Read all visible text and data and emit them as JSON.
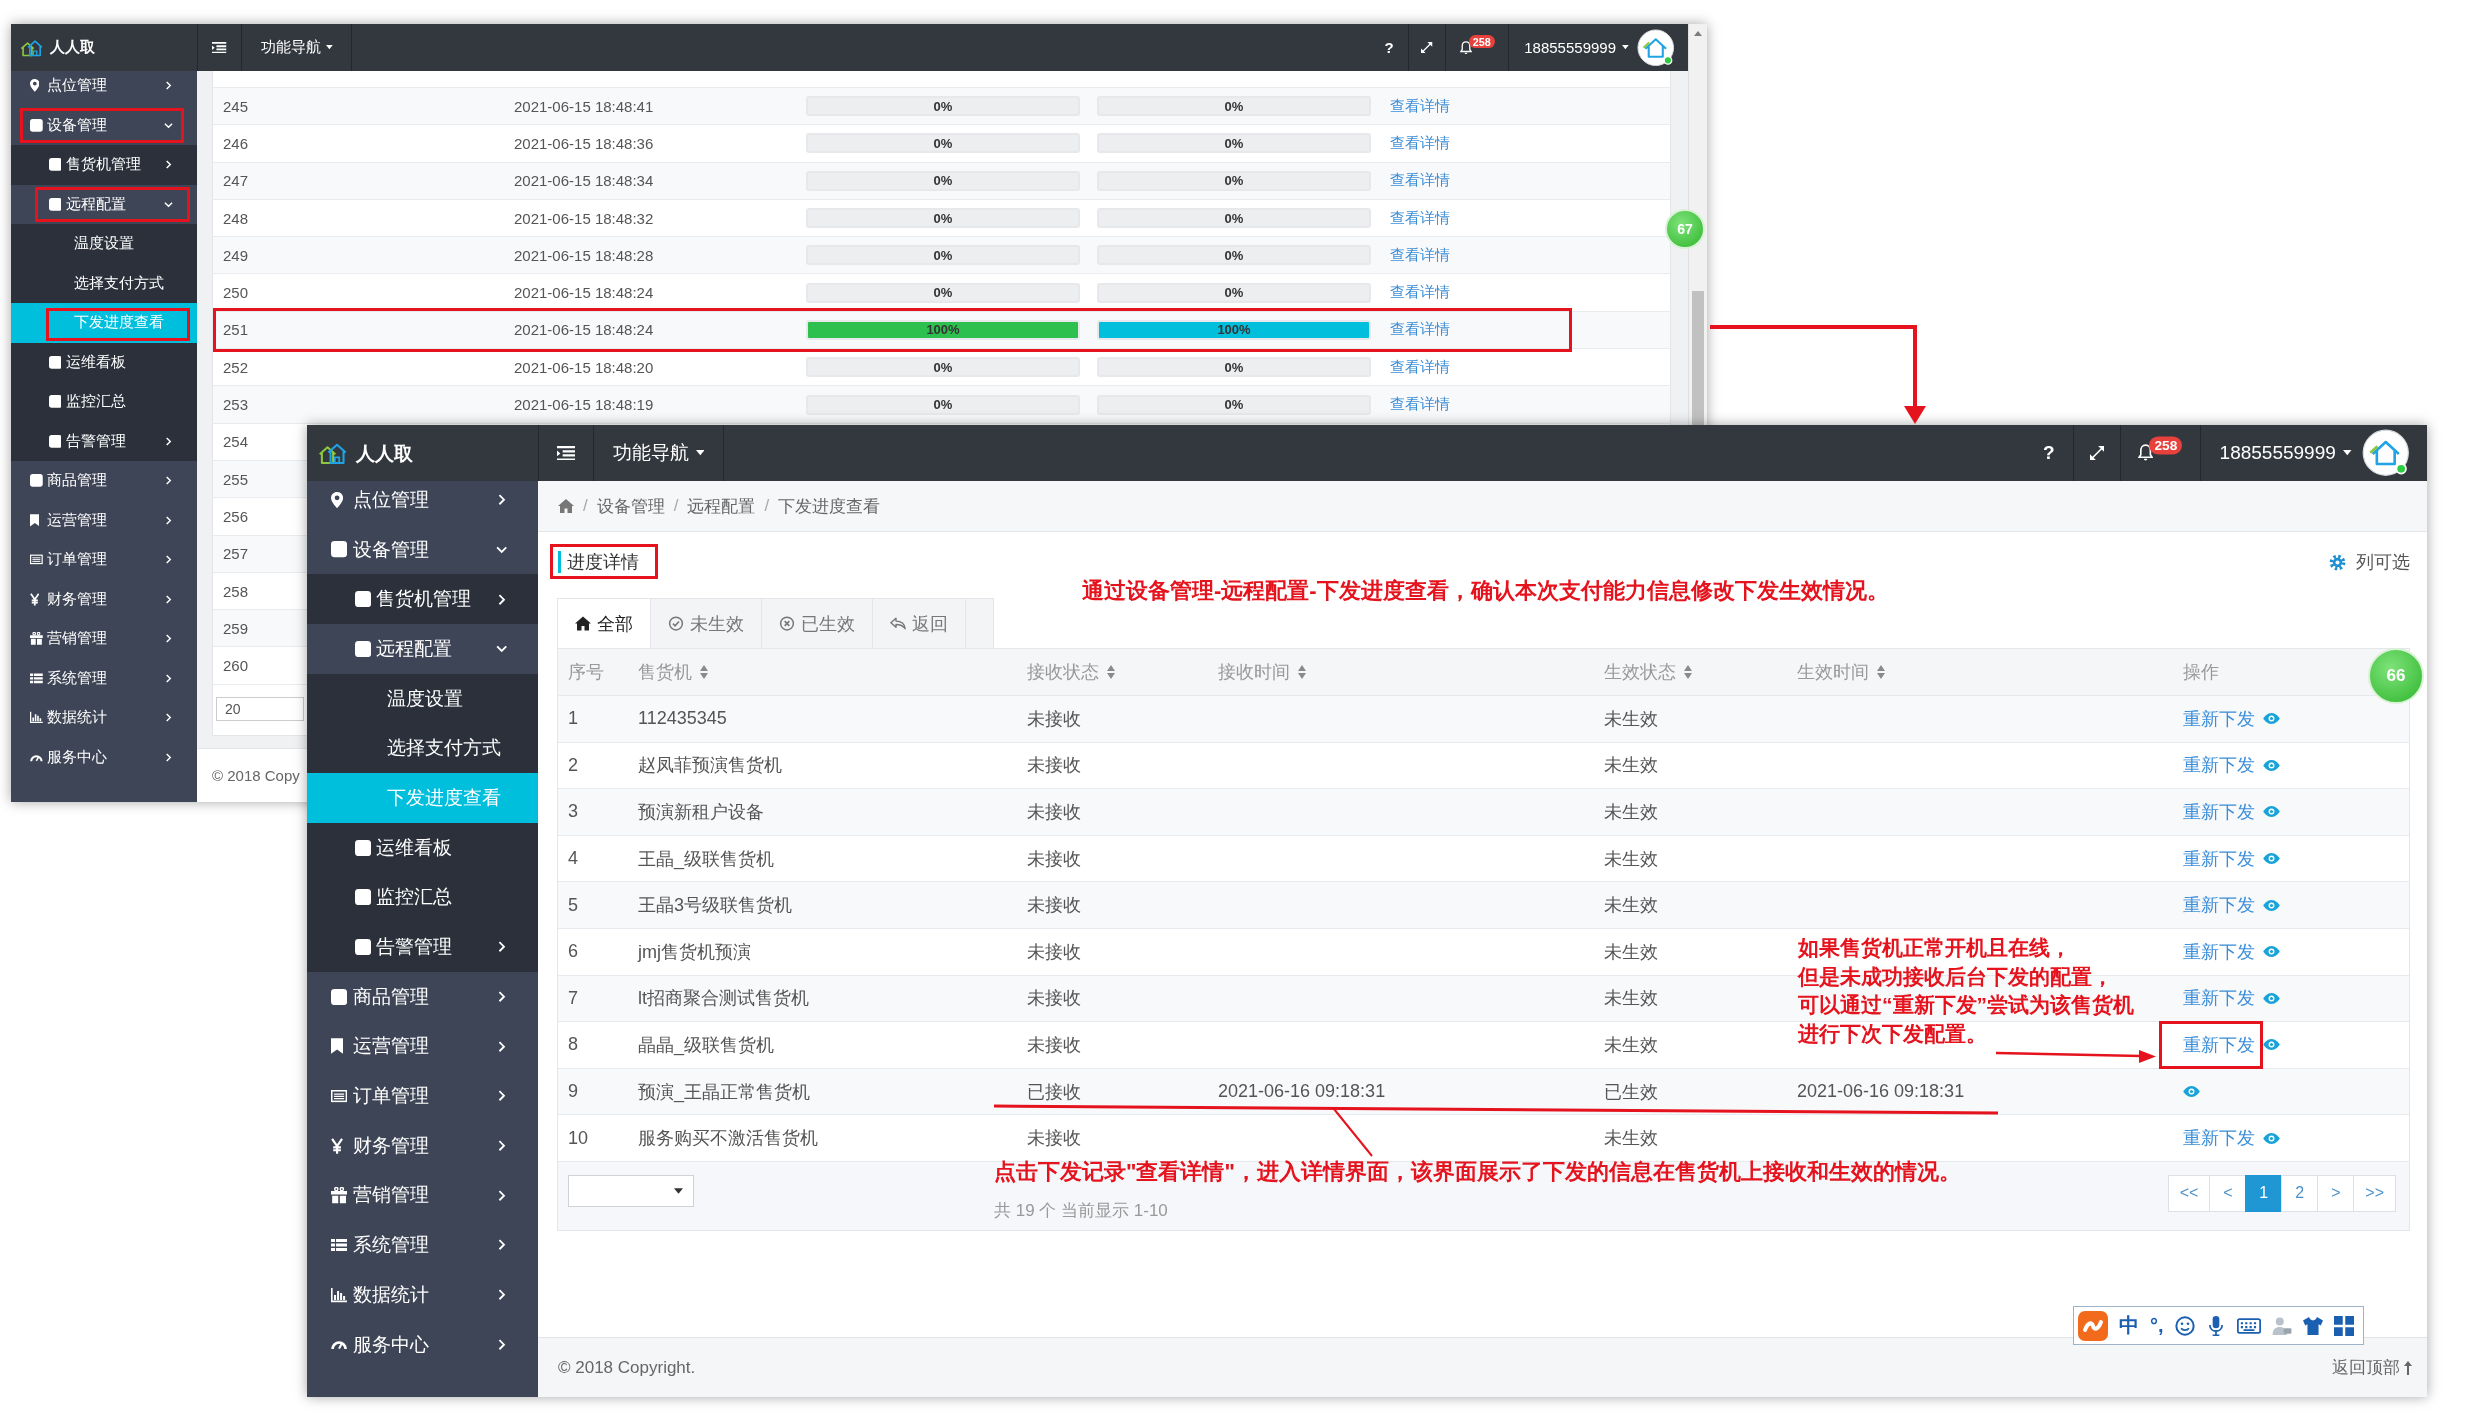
{
  "back_window": {
    "header": {
      "logo": "人人取",
      "nav": "功能导航",
      "help": "?",
      "notifications": "258",
      "user": "18855559999"
    },
    "sidebar": [
      {
        "label": "点位管理",
        "selected": false,
        "expanded": false,
        "highlighted": false
      },
      {
        "label": "设备管理",
        "selected": false,
        "expanded": true,
        "highlighted": true,
        "children": [
          {
            "label": "售货机管理",
            "selected": false,
            "expanded": false,
            "highlighted": false
          },
          {
            "label": "远程配置",
            "selected": false,
            "expanded": true,
            "highlighted": true,
            "children": [
              {
                "label": "温度设置",
                "selected": false,
                "highlighted": false
              },
              {
                "label": "选择支付方式",
                "selected": false,
                "highlighted": false
              },
              {
                "label": "下发进度查看",
                "selected": true,
                "highlighted": true
              }
            ]
          },
          {
            "label": "运维看板",
            "selected": false,
            "highlighted": false
          },
          {
            "label": "监控汇总",
            "selected": false,
            "highlighted": false
          },
          {
            "label": "告警管理",
            "selected": false,
            "expanded": false,
            "highlighted": false
          }
        ]
      },
      {
        "label": "商品管理",
        "selected": false,
        "expanded": false,
        "highlighted": false
      },
      {
        "label": "运营管理",
        "selected": false,
        "expanded": false,
        "highlighted": false
      },
      {
        "label": "订单管理",
        "selected": false,
        "expanded": false,
        "highlighted": false
      },
      {
        "label": "财务管理",
        "selected": false,
        "expanded": false,
        "highlighted": false
      },
      {
        "label": "营销管理",
        "selected": false,
        "expanded": false,
        "highlighted": false
      },
      {
        "label": "系统管理",
        "selected": false,
        "expanded": false,
        "highlighted": false
      },
      {
        "label": "数据统计",
        "selected": false,
        "expanded": false,
        "highlighted": false
      },
      {
        "label": "服务中心",
        "selected": false,
        "expanded": false,
        "highlighted": false
      }
    ],
    "rows": [
      {
        "column_1": "245",
        "column_2": "2021-06-15 18:48:41",
        "column_3": {
          "label": "0%"
        },
        "column_4": {
          "label": "0%"
        },
        "column_5": "查看详情",
        "highlighted": false
      },
      {
        "column_1": "246",
        "column_2": "2021-06-15 18:48:36",
        "column_3": {
          "label": "0%"
        },
        "column_4": {
          "label": "0%"
        },
        "column_5": "查看详情",
        "highlighted": false
      },
      {
        "column_1": "247",
        "column_2": "2021-06-15 18:48:34",
        "column_3": {
          "label": "0%"
        },
        "column_4": {
          "label": "0%"
        },
        "column_5": "查看详情",
        "highlighted": false
      },
      {
        "column_1": "248",
        "column_2": "2021-06-15 18:48:32",
        "column_3": {
          "label": "0%"
        },
        "column_4": {
          "label": "0%"
        },
        "column_5": "查看详情",
        "highlighted": false
      },
      {
        "column_1": "249",
        "column_2": "2021-06-15 18:48:28",
        "column_3": {
          "label": "0%"
        },
        "column_4": {
          "label": "0%"
        },
        "column_5": "查看详情",
        "highlighted": false
      },
      {
        "column_1": "250",
        "column_2": "2021-06-15 18:48:24",
        "column_3": {
          "label": "0%"
        },
        "column_4": {
          "label": "0%"
        },
        "column_5": "查看详情",
        "highlighted": false
      },
      {
        "column_1": "251",
        "column_2": "2021-06-15 18:48:24",
        "column_3": {
          "level": 1,
          "label": "100%"
        },
        "column_4": {
          "level": 1,
          "label": "100%"
        },
        "column_5": "查看详情",
        "highlighted": true
      },
      {
        "column_1": "252",
        "column_2": "2021-06-15 18:48:20",
        "column_3": {
          "label": "0%"
        },
        "column_4": {
          "label": "0%"
        },
        "column_5": "查看详情",
        "highlighted": false
      },
      {
        "column_1": "253",
        "column_2": "2021-06-15 18:48:19",
        "column_3": {
          "label": "0%"
        },
        "column_4": {
          "label": "0%"
        },
        "column_5": "查看详情",
        "highlighted": false
      },
      {
        "column_1": "254",
        "highlighted": false
      },
      {
        "column_1": "255",
        "highlighted": false
      },
      {
        "column_1": "256",
        "highlighted": false
      },
      {
        "column_1": "257",
        "highlighted": false
      },
      {
        "column_1": "258",
        "highlighted": false
      },
      {
        "column_1": "259",
        "highlighted": false
      },
      {
        "column_1": "260",
        "highlighted": false
      }
    ],
    "page_size": "20",
    "footer": "© 2018 Copy",
    "floating_badge": "67"
  },
  "front_window": {
    "header": {
      "logo": "人人取",
      "nav": "功能导航",
      "help": "?",
      "notifications": "258",
      "user": "18855559999"
    },
    "sidebar": [
      {
        "label": "点位管理",
        "selected": false,
        "expanded": false
      },
      {
        "label": "设备管理",
        "selected": false,
        "expanded": true,
        "children": [
          {
            "label": "售货机管理",
            "selected": false,
            "expanded": false
          },
          {
            "label": "远程配置",
            "selected": false,
            "expanded": true,
            "children": [
              {
                "label": "温度设置",
                "selected": false
              },
              {
                "label": "选择支付方式",
                "selected": false
              },
              {
                "label": "下发进度查看",
                "selected": true
              }
            ]
          },
          {
            "label": "运维看板",
            "selected": false
          },
          {
            "label": "监控汇总",
            "selected": false
          },
          {
            "label": "告警管理",
            "selected": false,
            "expanded": false
          }
        ]
      },
      {
        "label": "商品管理",
        "selected": false,
        "expanded": false
      },
      {
        "label": "运营管理",
        "selected": false,
        "expanded": false
      },
      {
        "label": "订单管理",
        "selected": false,
        "expanded": false
      },
      {
        "label": "财务管理",
        "selected": false,
        "expanded": false
      },
      {
        "label": "营销管理",
        "selected": false,
        "expanded": false
      },
      {
        "label": "系统管理",
        "selected": false,
        "expanded": false
      },
      {
        "label": "数据统计",
        "selected": false,
        "expanded": false
      },
      {
        "label": "服务中心",
        "selected": false,
        "expanded": false
      }
    ],
    "breadcrumb": [
      {
        "kind": "home"
      },
      {
        "kind": "separator",
        "label": "/"
      },
      {
        "kind": "link",
        "label": "设备管理"
      },
      {
        "kind": "separator",
        "label": "/"
      },
      {
        "kind": "link",
        "label": "远程配置"
      },
      {
        "kind": "separator",
        "label": "/"
      },
      {
        "kind": "current",
        "label": "下发进度查看"
      }
    ],
    "panel": {
      "title": "进度详情",
      "title_highlighted": true,
      "column_picker": "列可选"
    },
    "tabs": [
      {
        "label": "全部",
        "selected": true
      },
      {
        "label": "未生效",
        "selected": false
      },
      {
        "label": "已生效",
        "selected": false
      },
      {
        "label": "返回",
        "selected": false
      }
    ],
    "table": {
      "columns": [
        {
          "label": "序号",
          "sortable": false
        },
        {
          "label": "售货机",
          "sortable": true
        },
        {
          "label": "接收状态",
          "sortable": true
        },
        {
          "label": "接收时间",
          "sortable": true
        },
        {
          "label": "生效状态",
          "sortable": true
        },
        {
          "label": "生效时间",
          "sortable": true
        },
        {
          "label": "操作",
          "sortable": false
        }
      ],
      "rows": [
        {
          "no": "1",
          "machine": "112435345",
          "receive_status": "未接收",
          "effect_status": "未生效",
          "action": "重新下发",
          "highlighted": false
        },
        {
          "no": "2",
          "machine": "赵凤菲预演售货机",
          "receive_status": "未接收",
          "effect_status": "未生效",
          "action": "重新下发",
          "highlighted": false
        },
        {
          "no": "3",
          "machine": "预演新租户设备",
          "receive_status": "未接收",
          "effect_status": "未生效",
          "action": "重新下发",
          "highlighted": false
        },
        {
          "no": "4",
          "machine": "王晶_级联售货机",
          "receive_status": "未接收",
          "effect_status": "未生效",
          "action": "重新下发",
          "highlighted": false
        },
        {
          "no": "5",
          "machine": "王晶3号级联售货机",
          "receive_status": "未接收",
          "effect_status": "未生效",
          "action": "重新下发",
          "highlighted": false
        },
        {
          "no": "6",
          "machine": "jmj售货机预演",
          "receive_status": "未接收",
          "effect_status": "未生效",
          "action": "重新下发",
          "highlighted": false
        },
        {
          "no": "7",
          "machine": "lt招商聚合测试售货机",
          "receive_status": "未接收",
          "effect_status": "未生效",
          "action": "重新下发",
          "highlighted": false
        },
        {
          "no": "8",
          "machine": "晶晶_级联售货机",
          "receive_status": "未接收",
          "effect_status": "未生效",
          "action": "重新下发",
          "highlighted": true
        },
        {
          "no": "9",
          "machine": "预演_王晶正常售货机",
          "receive_status": "已接收",
          "receive_time": "2021-06-16 09:18:31",
          "effect_status": "已生效",
          "effect_time": "2021-06-16 09:18:31",
          "highlighted": false
        },
        {
          "no": "10",
          "machine": "服务购买不激活售货机",
          "receive_status": "未接收",
          "effect_status": "未生效",
          "action": "重新下发",
          "highlighted": false
        }
      ]
    },
    "summary": "共 19 个 当前显示 1-10",
    "pagination": [
      {
        "label": "<<",
        "selected": false
      },
      {
        "label": "<",
        "selected": false
      },
      {
        "label": "1",
        "selected": true
      },
      {
        "label": "2",
        "selected": false
      },
      {
        "label": ">",
        "selected": false
      },
      {
        "label": ">>",
        "selected": false
      }
    ],
    "footer": "© 2018 Copyright.",
    "back_to_top": "返回顶部",
    "floating_badge": "66",
    "ime_toolbar": {
      "mode": "中",
      "punctuation": "°,"
    }
  },
  "annotations": {
    "top_note": "通过设备管理-远程配置-下发进度查看，确认本次支付能力信息修改下发生效情况。",
    "side_note": [
      "如果售货机正常开机且在线，",
      "但是未成功接收后台下发的配置，",
      "可以通过“重新下发”尝试为该售货机",
      "进行下次下发配置。"
    ],
    "bottom_note": "点击下发记录\"查看详情\"，进入详情界面，该界面展示了下发的信息在售货机上接收和生效的情况。"
  }
}
